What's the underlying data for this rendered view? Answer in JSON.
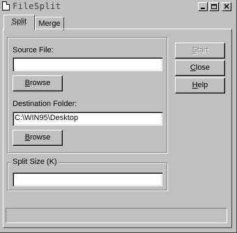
{
  "window": {
    "title": "FileSplit"
  },
  "titlebar_buttons": {
    "minimize": "_",
    "maximize": "□",
    "close": "×"
  },
  "tabs": [
    {
      "label": "Split",
      "active": true
    },
    {
      "label": "Merge",
      "active": false
    }
  ],
  "source": {
    "label": "Source File:",
    "value": "",
    "browse_label": "Browse",
    "browse_accel": "B",
    "browse_rest": "rowse"
  },
  "destination": {
    "label": "Destination Folder:",
    "value": "C:\\WIN95\\Desktop",
    "browse_accel": "B",
    "browse_rest": "rowse"
  },
  "split_size": {
    "label": "Split Size (K)",
    "value": ""
  },
  "actions": {
    "start": {
      "accel": "S",
      "rest": "tart",
      "enabled": false
    },
    "close": {
      "accel": "C",
      "rest": "lose",
      "enabled": true
    },
    "help": {
      "accel": "H",
      "rest": "elp",
      "enabled": true
    }
  },
  "status": {
    "text": ""
  }
}
